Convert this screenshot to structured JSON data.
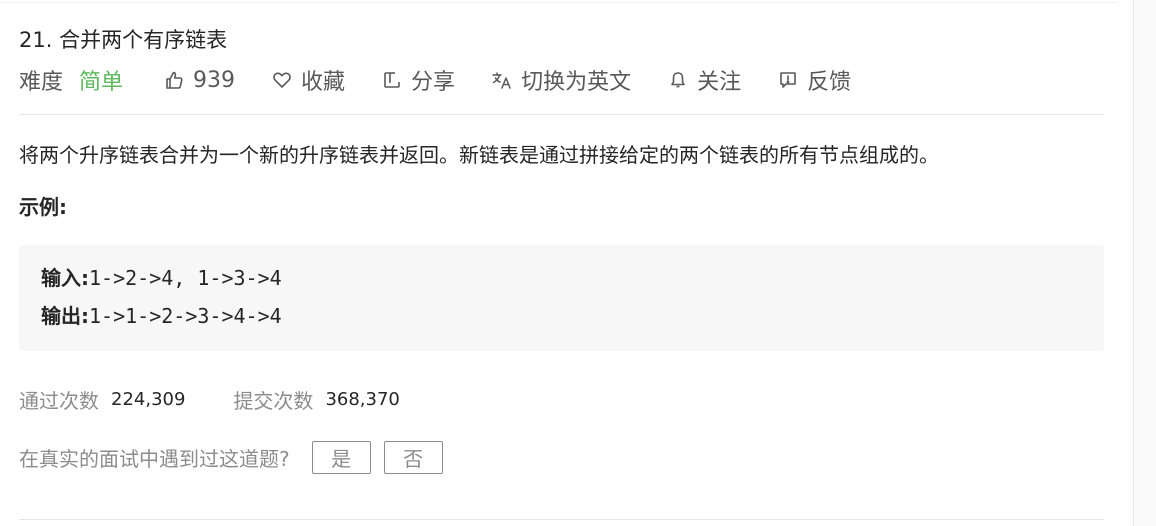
{
  "problem": {
    "title": "21. 合并两个有序链表",
    "difficulty_label": "难度",
    "difficulty_value": "简单",
    "difficulty_color": "#5cb85c"
  },
  "actions": {
    "likes": "939",
    "favorite_label": "收藏",
    "share_label": "分享",
    "switch_lang_label": "切换为英文",
    "follow_label": "关注",
    "feedback_label": "反馈",
    "icons": [
      "thumbs-up-icon",
      "heart-icon",
      "share-icon",
      "translate-icon",
      "bell-icon",
      "feedback-icon"
    ]
  },
  "description": {
    "text": "将两个升序链表合并为一个新的升序链表并返回。新链表是通过拼接给定的两个链表的所有节点组成的。",
    "example_heading": "示例:"
  },
  "example": {
    "input_label": "输入:",
    "input_value": "1->2->4, 1->3->4",
    "output_label": "输出:",
    "output_value": "1->1->2->3->4->4"
  },
  "stats": {
    "accepted_label": "通过次数",
    "accepted_value": "224,309",
    "submitted_label": "提交次数",
    "submitted_value": "368,370"
  },
  "interview": {
    "question": "在真实的面试中遇到过这道题?",
    "yes_label": "是",
    "no_label": "否"
  }
}
